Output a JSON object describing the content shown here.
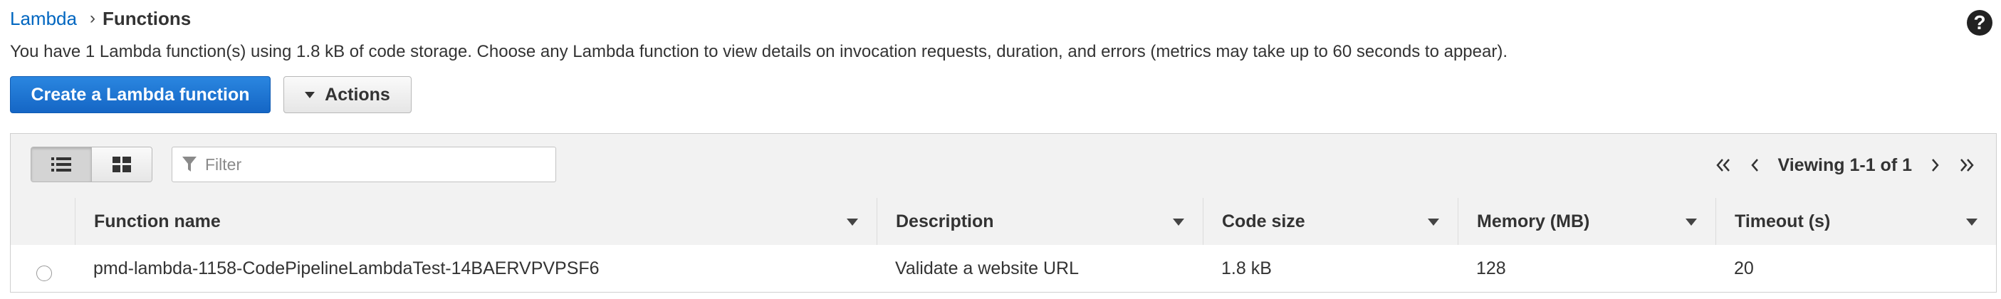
{
  "breadcrumb": {
    "root": "Lambda",
    "separator": "›",
    "current": "Functions"
  },
  "help": {
    "label": "?"
  },
  "summary": "You have 1 Lambda function(s) using 1.8 kB of code storage. Choose any Lambda function to view details on invocation requests, duration, and errors (metrics may take up to 60 seconds to appear).",
  "buttons": {
    "create": "Create a Lambda function",
    "actions": "Actions"
  },
  "filter": {
    "placeholder": "Filter",
    "value": ""
  },
  "pager": {
    "first_icon": "«",
    "prev_icon": "‹",
    "viewing": "Viewing 1-1 of 1",
    "next_icon": "›",
    "last_icon": "»"
  },
  "table": {
    "columns": [
      "Function name",
      "Description",
      "Code size",
      "Memory (MB)",
      "Timeout (s)"
    ],
    "rows": [
      {
        "function_name": "pmd-lambda-1158-CodePipelineLambdaTest-14BAERVPVPSF6",
        "description": "Validate a website URL",
        "code_size": "1.8 kB",
        "memory": "128",
        "timeout": "20"
      }
    ]
  },
  "colors": {
    "link": "#0066c0",
    "primary_button": "#1a6fcf",
    "toolbar_bg": "#f2f2f2"
  },
  "icons": {
    "help": "question-circle-icon",
    "list_view": "list-view-icon",
    "grid_view": "grid-view-icon",
    "filter": "funnel-icon",
    "actions_caret": "caret-down-icon"
  }
}
